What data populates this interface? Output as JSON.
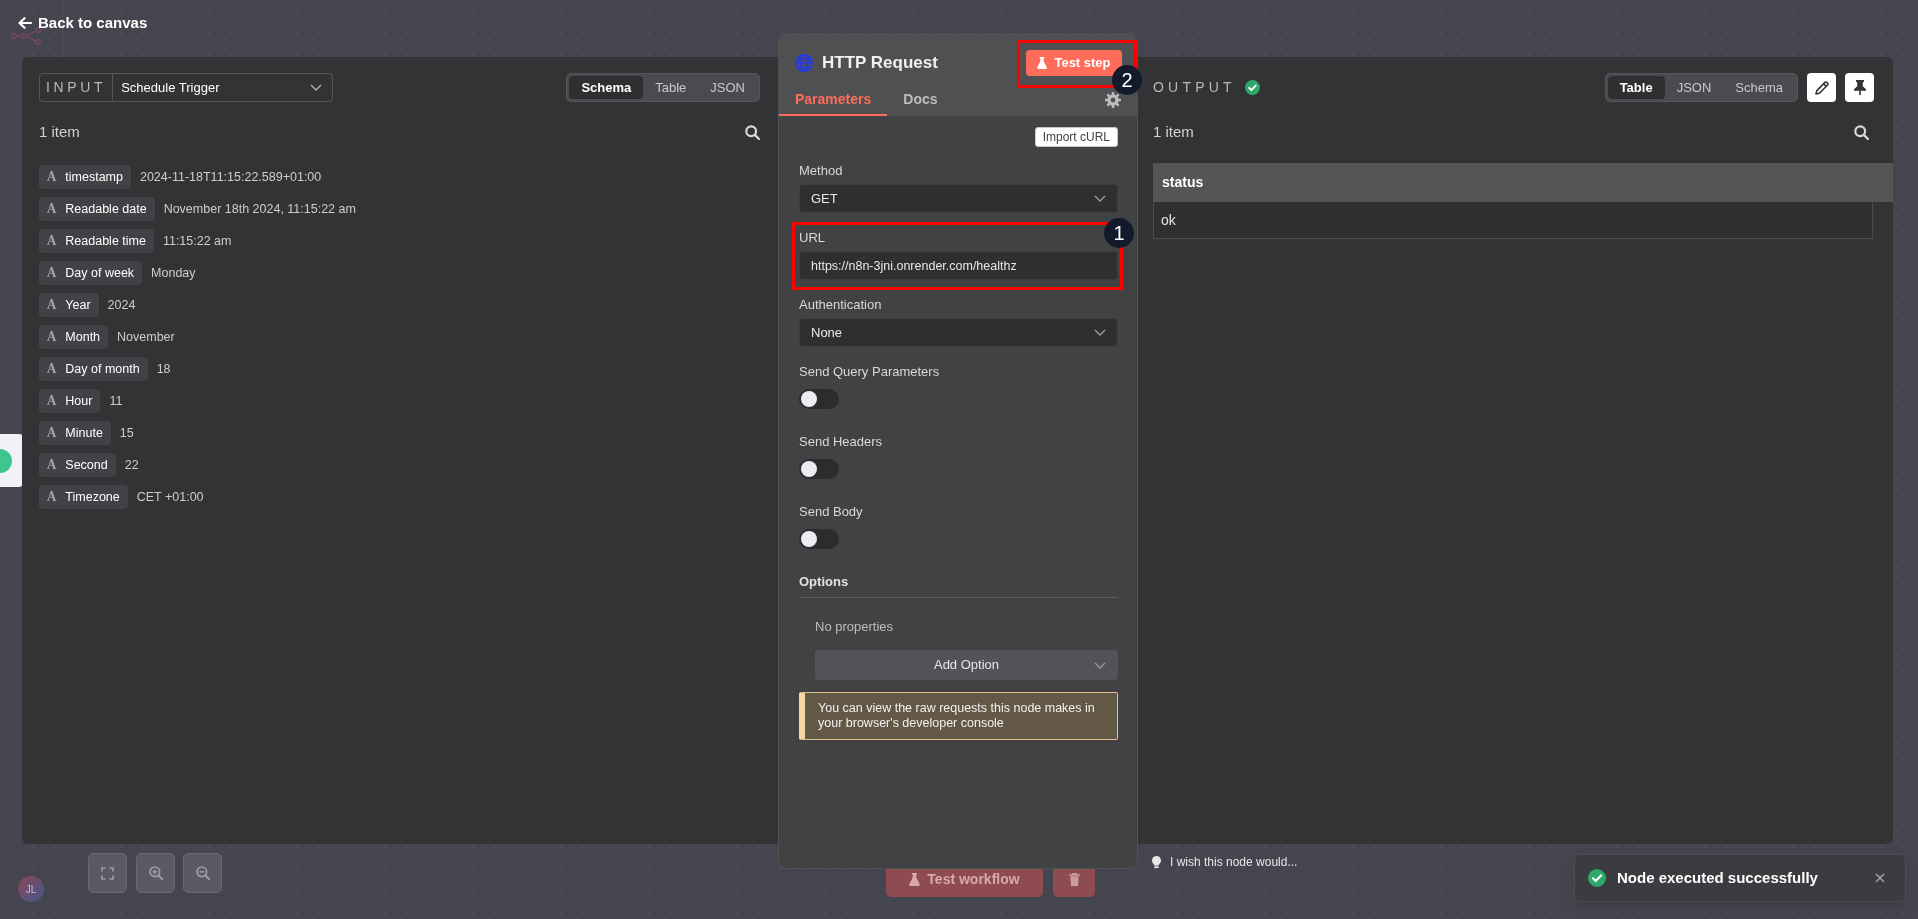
{
  "top_bar": {
    "back_link": "Back to canvas"
  },
  "input_panel": {
    "label": "INPUT",
    "node_select": "Schedule Trigger",
    "view_tabs": [
      {
        "label": "Schema",
        "selected": true
      },
      {
        "label": "Table",
        "selected": false
      },
      {
        "label": "JSON",
        "selected": false
      }
    ],
    "item_count": "1 item",
    "fields": [
      {
        "type": "A",
        "name": "timestamp",
        "value": "2024-11-18T11:15:22.589+01:00"
      },
      {
        "type": "A",
        "name": "Readable date",
        "value": "November 18th 2024, 11:15:22 am"
      },
      {
        "type": "A",
        "name": "Readable time",
        "value": "11:15:22 am"
      },
      {
        "type": "A",
        "name": "Day of week",
        "value": "Monday"
      },
      {
        "type": "A",
        "name": "Year",
        "value": "2024"
      },
      {
        "type": "A",
        "name": "Month",
        "value": "November"
      },
      {
        "type": "A",
        "name": "Day of month",
        "value": "18"
      },
      {
        "type": "A",
        "name": "Hour",
        "value": "11"
      },
      {
        "type": "A",
        "name": "Minute",
        "value": "15"
      },
      {
        "type": "A",
        "name": "Second",
        "value": "22"
      },
      {
        "type": "A",
        "name": "Timezone",
        "value": "CET +01:00"
      }
    ]
  },
  "node_panel": {
    "title": "HTTP Request",
    "test_button": {
      "label": "Test step",
      "callout": "2"
    },
    "tabs": [
      {
        "label": "Parameters",
        "selected": true
      },
      {
        "label": "Docs",
        "selected": false
      }
    ],
    "import_button": "Import cURL",
    "parameters": [
      {
        "kind": "select",
        "label": "Method",
        "value": "GET"
      },
      {
        "kind": "input",
        "label": "URL",
        "value": "https://n8n-3jni.onrender.com/healthz",
        "callout": "1"
      },
      {
        "kind": "select",
        "label": "Authentication",
        "value": "None"
      },
      {
        "kind": "toggle",
        "label": "Send Query Parameters",
        "on": false
      },
      {
        "kind": "toggle",
        "label": "Send Headers",
        "on": false
      },
      {
        "kind": "toggle",
        "label": "Send Body",
        "on": false
      }
    ],
    "options": {
      "label": "Options",
      "empty_text": "No properties",
      "add_button": "Add Option"
    },
    "notice": "You can view the raw requests this node makes in your browser's developer console",
    "feedback_link": "I wish this node would..."
  },
  "output_panel": {
    "label": "OUTPUT",
    "success": true,
    "view_tabs": [
      {
        "label": "Table",
        "selected": true
      },
      {
        "label": "JSON",
        "selected": false
      },
      {
        "label": "Schema",
        "selected": false
      }
    ],
    "item_count": "1 item",
    "table": {
      "columns": [
        "status"
      ],
      "rows": [
        [
          "ok"
        ]
      ]
    }
  },
  "canvas": {
    "avatar": "JL",
    "run_button": "Test workflow"
  },
  "toast": {
    "message": "Node executed successfully"
  }
}
